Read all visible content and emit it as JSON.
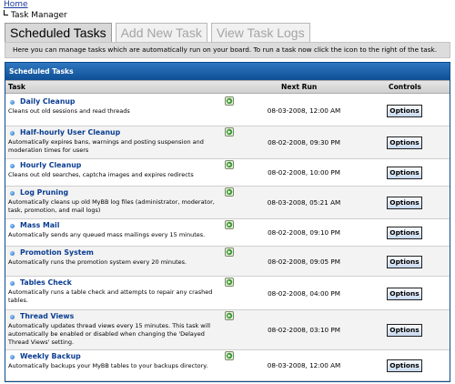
{
  "breadcrumb": {
    "home": "Home",
    "current": "Task Manager"
  },
  "tabs": [
    {
      "label": "Scheduled Tasks",
      "active": true
    },
    {
      "label": "Add New Task",
      "active": false
    },
    {
      "label": "View Task Logs",
      "active": false
    }
  ],
  "intro_text": "Here you can manage tasks which are automatically run on your board. To run a task now click the icon to the right of the task.",
  "panel": {
    "title": "Scheduled Tasks",
    "headers": {
      "task": "Task",
      "next_run": "Next Run",
      "controls": "Controls"
    }
  },
  "options_label": "Options",
  "tasks": [
    {
      "name": "Daily Cleanup",
      "description": "Cleans out old sessions and read threads",
      "next_run": "08-03-2008, 12:00 AM"
    },
    {
      "name": "Half-hourly User Cleanup",
      "description": "Automatically expires bans, warnings and posting suspension and moderation times for users",
      "next_run": "08-02-2008, 09:30 PM"
    },
    {
      "name": "Hourly Cleanup",
      "description": "Cleans out old searches, captcha images and expires redirects",
      "next_run": "08-02-2008, 10:00 PM"
    },
    {
      "name": "Log Pruning",
      "description": "Automatically cleans up old MyBB log files (administrator, moderator, task, promotion, and mail logs)",
      "next_run": "08-03-2008, 05:21 AM"
    },
    {
      "name": "Mass Mail",
      "description": "Automatically sends any queued mass mailings every 15 minutes.",
      "next_run": "08-02-2008, 09:10 PM"
    },
    {
      "name": "Promotion System",
      "description": "Automatically runs the promotion system every 20 minutes.",
      "next_run": "08-02-2008, 09:05 PM"
    },
    {
      "name": "Tables Check",
      "description": "Automatically runs a table check and attempts to repair any crashed tables.",
      "next_run": "08-02-2008, 04:00 PM"
    },
    {
      "name": "Thread Views",
      "description": "Automatically updates thread views every 15 minutes. This task will automatically be enabled or disabled when changing the 'Delayed Thread Views' setting.",
      "next_run": "08-02-2008, 03:10 PM"
    },
    {
      "name": "Weekly Backup",
      "description": "Automatically backups your MyBB tables to your backups directory.",
      "next_run": "08-03-2008, 12:00 AM"
    }
  ],
  "colors": {
    "panel_header": "#1a5fa8",
    "link": "#0a3d91",
    "row_alt": "#f3f3f3"
  },
  "icons": {
    "run_task": "run-task-icon"
  }
}
